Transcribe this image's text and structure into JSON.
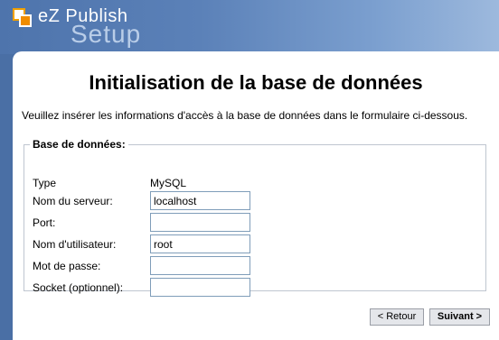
{
  "header": {
    "brand": "eZ Publish",
    "subtitle": "Setup"
  },
  "page": {
    "title": "Initialisation de la base de données",
    "intro": "Veuillez insérer les informations d'accès à la base de données dans le formulaire ci-dessous."
  },
  "form": {
    "legend": "Base de données:",
    "type_label": "Type",
    "type_value": "MySQL",
    "fields": [
      {
        "label": "Nom du serveur:",
        "value": "localhost"
      },
      {
        "label": "Port:",
        "value": ""
      },
      {
        "label": "Nom d'utilisateur:",
        "value": "root"
      },
      {
        "label": "Mot de passe:",
        "value": ""
      },
      {
        "label": "Socket (optionnel):",
        "value": ""
      }
    ]
  },
  "buttons": {
    "back": "< Retour",
    "next": "Suivant >"
  },
  "colors": {
    "accent": "#4e74ac",
    "logo_orange": "#f08c00"
  }
}
